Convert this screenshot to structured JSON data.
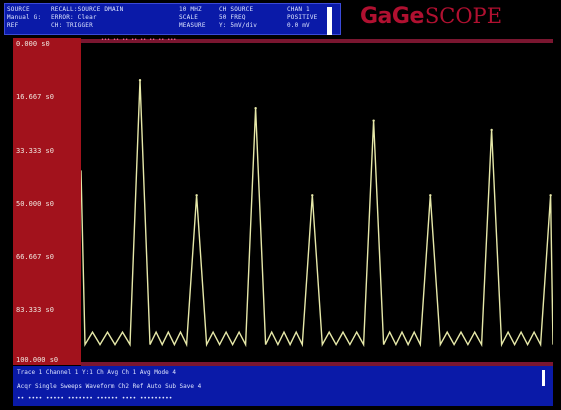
{
  "window": {
    "brand": "GaGe",
    "product": "SCOPE"
  },
  "status": {
    "col1": [
      "SOURCE",
      "Manual G:",
      "REF"
    ],
    "col2": [
      "RECALL:SOURCE DMAIN",
      "ERROR: Clear",
      "CH: TRIGGER"
    ],
    "col3": [
      "10 MHZ",
      "SCALE",
      "MEASURE"
    ],
    "col4": [
      "CH SOURCE",
      "50 FREQ",
      "Y: 5mV/div"
    ],
    "col5": [
      "CHAN 1",
      "POSITIVE",
      "0.0 mV"
    ]
  },
  "plot": {
    "y_ticks": [
      "0.000 s0",
      "16.667 s0",
      "33.333 s0",
      "50.000 s0",
      "66.667 s0",
      "83.333 s0",
      "100.000 s0"
    ],
    "top_strip_text": "••• •• •• •• •• •• •• •••",
    "trace_color": "#e6e8a8"
  },
  "chart_data": {
    "type": "line",
    "xlabel": "",
    "ylabel": "",
    "peaks": [
      {
        "x": 0.125,
        "y": 0.89
      },
      {
        "x": 0.245,
        "y": 0.52
      },
      {
        "x": 0.37,
        "y": 0.8
      },
      {
        "x": 0.49,
        "y": 0.52
      },
      {
        "x": 0.62,
        "y": 0.76
      },
      {
        "x": 0.74,
        "y": 0.52
      },
      {
        "x": 0.87,
        "y": 0.73
      },
      {
        "x": 0.995,
        "y": 0.52
      }
    ],
    "baseline": 0.04
  },
  "footer": {
    "row1": "Trace 1     Channel 1     Y:1 Ch Avg    Ch 1 Avg     Mode 4",
    "row2": "Acqr  Single Sweeps     Waveform    Ch2 Ref     Auto Sub    Save 4",
    "row3": "•• •••• ••••• ••••••• •••••• •••• •••••••••"
  }
}
